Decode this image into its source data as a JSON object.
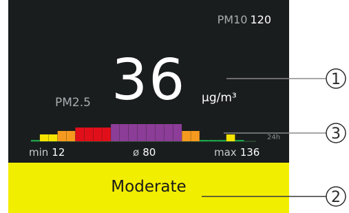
{
  "pm10": {
    "label": "PM10",
    "value": "120"
  },
  "pm25": {
    "label": "PM2.5",
    "value": "36",
    "unit": "µg/m³"
  },
  "history": {
    "period_label": "24h",
    "bars": [
      {
        "color": "#1aa64b",
        "level": 1
      },
      {
        "color": "#f4e400",
        "level": 2
      },
      {
        "color": "#f4e400",
        "level": 2
      },
      {
        "color": "#f59a1f",
        "level": 3
      },
      {
        "color": "#f59a1f",
        "level": 3
      },
      {
        "color": "#e10f1a",
        "level": 4
      },
      {
        "color": "#e10f1a",
        "level": 4
      },
      {
        "color": "#e10f1a",
        "level": 4
      },
      {
        "color": "#e10f1a",
        "level": 4
      },
      {
        "color": "#8c3d97",
        "level": 5
      },
      {
        "color": "#8c3d97",
        "level": 5
      },
      {
        "color": "#8c3d97",
        "level": 5
      },
      {
        "color": "#8c3d97",
        "level": 5
      },
      {
        "color": "#8c3d97",
        "level": 5
      },
      {
        "color": "#8c3d97",
        "level": 5
      },
      {
        "color": "#8c3d97",
        "level": 5
      },
      {
        "color": "#8c3d97",
        "level": 5
      },
      {
        "color": "#f59a1f",
        "level": 3
      },
      {
        "color": "#f59a1f",
        "level": 3
      },
      {
        "color": "#1aa64b",
        "level": 1
      },
      {
        "color": "#1aa64b",
        "level": 1
      },
      {
        "color": "#1aa64b",
        "level": 1
      },
      {
        "color": "#f4e400",
        "level": 2
      },
      {
        "color": "#1aa64b",
        "level": 1
      }
    ]
  },
  "stats": {
    "min_label": "min",
    "min_value": "12",
    "avg_label": "ø",
    "avg_value": "80",
    "max_label": "max",
    "max_value": "136"
  },
  "status": {
    "label": "Moderate",
    "color": "#f2ee00"
  },
  "callouts": [
    "1",
    "2",
    "3"
  ]
}
